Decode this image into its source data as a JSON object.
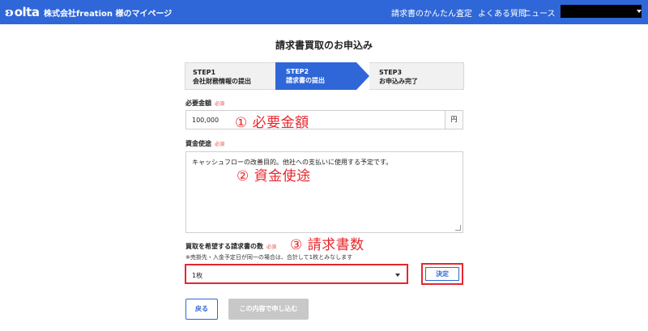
{
  "header": {
    "logo_mark": "ʚ",
    "logo_text": "olta",
    "company": "株式会社freation 様のマイページ",
    "nav": [
      {
        "label": "請求書のかんたん査定"
      },
      {
        "label": "よくある質問"
      },
      {
        "label": "ニュース"
      }
    ]
  },
  "page": {
    "title": "請求書買取のお申込み"
  },
  "steps": [
    {
      "num": "STEP1",
      "label": "会社財務情報の提出",
      "active": false
    },
    {
      "num": "STEP2",
      "label": "請求書の提出",
      "active": true
    },
    {
      "num": "STEP3",
      "label": "お申込み完了",
      "active": false
    }
  ],
  "form": {
    "required_badge": "必須",
    "amount": {
      "label": "必要金額",
      "value": "100,000",
      "unit": "円"
    },
    "usage": {
      "label": "資金使途",
      "value": "キャッシュフローの改善目的。他社への支払いに使用する予定です。"
    },
    "invoice_count": {
      "label": "買取を希望する請求書の数",
      "note": "※売掛先・入金予定日が同一の場合は、合計して1枚とみなします",
      "selected": "1枚",
      "decide_label": "決定"
    },
    "back_label": "戻る",
    "submit_label": "この内容で申し込む"
  },
  "annotations": [
    {
      "text": "① 必要金額"
    },
    {
      "text": "② 資金使途"
    },
    {
      "text": "③ 請求書数"
    }
  ],
  "colors": {
    "brand": "#2f67d8",
    "highlight": "#e8262c",
    "required": "#e04a4a",
    "disabled": "#c8c8c8"
  }
}
